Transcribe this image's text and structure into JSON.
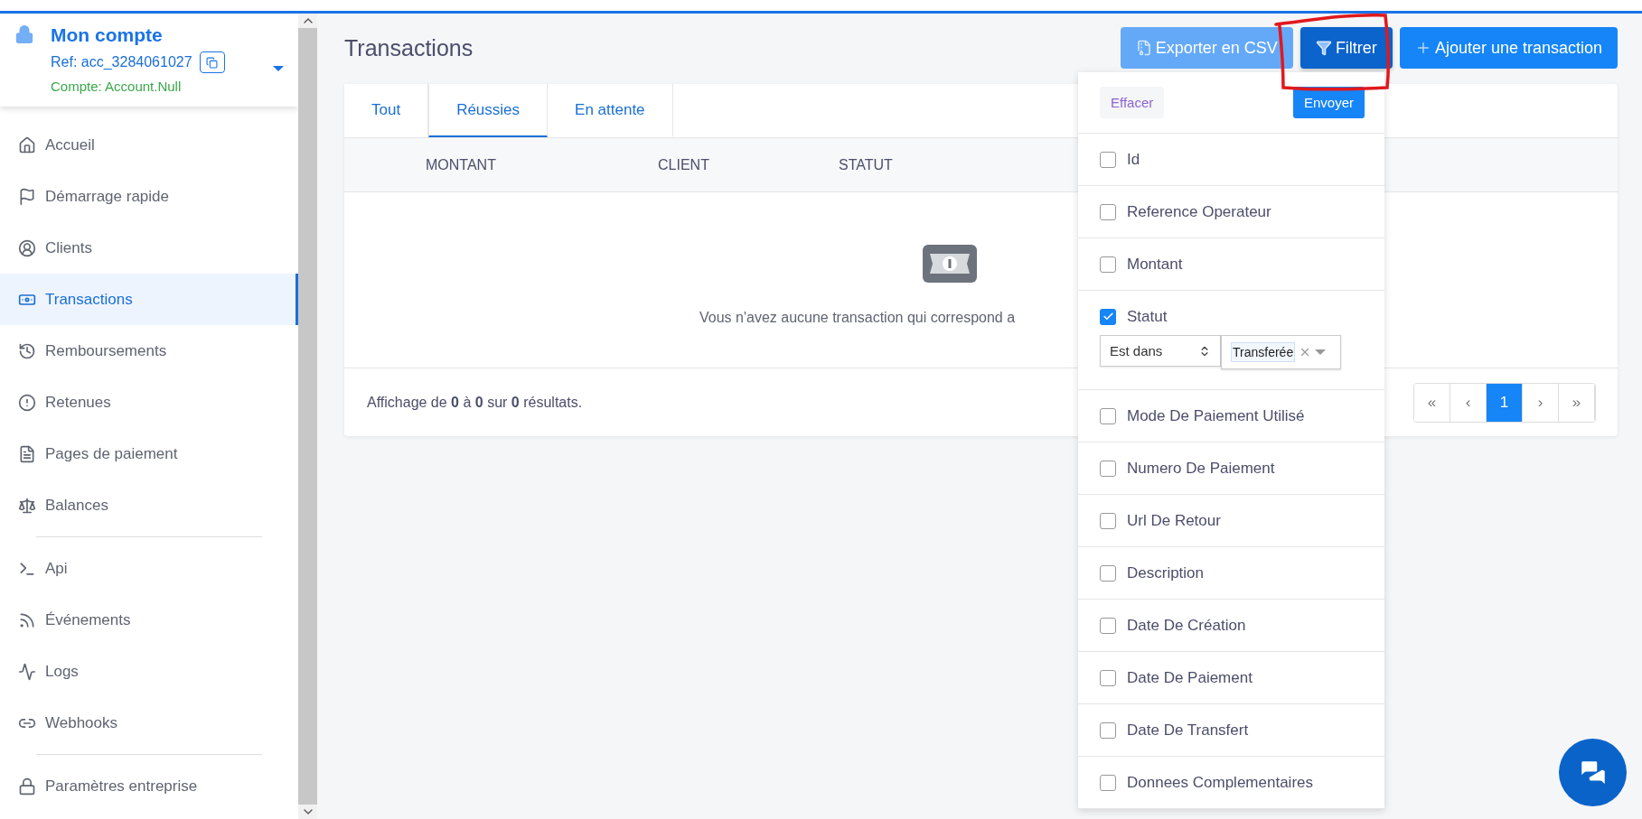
{
  "account": {
    "title": "Mon compte",
    "ref": "Ref: acc_3284061027",
    "compte": "Compte: Account.Null"
  },
  "sidebar": {
    "groups": [
      [
        {
          "label": "Accueil",
          "selected": false
        },
        {
          "label": "Démarrage rapide",
          "selected": false
        },
        {
          "label": "Clients",
          "selected": false
        },
        {
          "label": "Transactions",
          "selected": true
        },
        {
          "label": "Remboursements",
          "selected": false
        },
        {
          "label": "Retenues",
          "selected": false
        },
        {
          "label": "Pages de paiement",
          "selected": false
        },
        {
          "label": "Balances",
          "selected": false
        }
      ],
      [
        {
          "label": "Api",
          "selected": false
        },
        {
          "label": "Événements",
          "selected": false
        },
        {
          "label": "Logs",
          "selected": false
        },
        {
          "label": "Webhooks",
          "selected": false
        }
      ],
      [
        {
          "label": "Paramètres entreprise",
          "selected": false
        }
      ]
    ]
  },
  "page": {
    "title": "Transactions"
  },
  "actions": [
    {
      "kind": "export",
      "label": "Exporter en CSV"
    },
    {
      "kind": "filter",
      "label": "Filtrer"
    },
    {
      "kind": "add",
      "label": "Ajouter une transaction"
    }
  ],
  "tabs": [
    {
      "label": "Tout",
      "selected": false
    },
    {
      "label": "Réussies",
      "selected": true
    },
    {
      "label": "En attente",
      "selected": false
    }
  ],
  "table": {
    "columns": [
      "MONTANT",
      "CLIENT",
      "STATUT"
    ],
    "empty_message": "Vous n'avez aucune transaction qui correspond a",
    "summary": "Affichage de **0** à **0** sur **0** résultats."
  },
  "pagination": [
    {
      "label": "«",
      "selected": false
    },
    {
      "label": "‹",
      "selected": false
    },
    {
      "label": "1",
      "selected": true
    },
    {
      "label": "›",
      "selected": false
    },
    {
      "label": "»",
      "selected": false
    }
  ],
  "filter_panel": {
    "clear": "Effacer",
    "submit": "Envoyer",
    "fields": [
      {
        "label": "Id",
        "checked": false
      },
      {
        "label": "Reference Operateur",
        "checked": false
      },
      {
        "label": "Montant",
        "checked": false
      },
      {
        "label": "Statut",
        "checked": true,
        "operator": "Est dans",
        "value": "Transferée"
      },
      {
        "label": "Mode De Paiement Utilisé",
        "checked": false
      },
      {
        "label": "Numero De Paiement",
        "checked": false
      },
      {
        "label": "Url De Retour",
        "checked": false
      },
      {
        "label": "Description",
        "checked": false
      },
      {
        "label": "Date De Création",
        "checked": false
      },
      {
        "label": "Date De Paiement",
        "checked": false
      },
      {
        "label": "Date De Transfert",
        "checked": false
      },
      {
        "label": "Donnees Complementaires",
        "checked": false
      }
    ]
  }
}
